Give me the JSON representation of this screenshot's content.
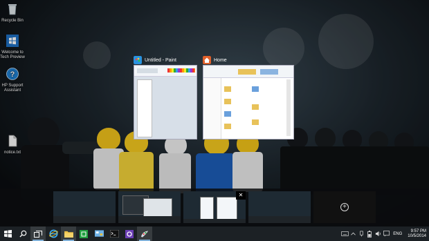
{
  "desktop": {
    "icons": [
      {
        "label": "Recycle Bin",
        "icon": "recycle-bin-icon"
      },
      {
        "label": "Welcome to Tech Preview",
        "icon": "windows-logo-icon"
      },
      {
        "label": "HP Support Assistant",
        "icon": "help-icon"
      },
      {
        "label": "notice.txt",
        "icon": "text-file-icon"
      }
    ]
  },
  "task_view": {
    "windows": [
      {
        "title": "Untitled - Paint",
        "icon": "paint-icon",
        "accent": "#1e90e0"
      },
      {
        "title": "Home",
        "icon": "home-icon",
        "accent": "#e06020"
      }
    ],
    "desktops": [
      {
        "name": "desktop-1"
      },
      {
        "name": "desktop-2"
      },
      {
        "name": "desktop-3",
        "close_symbol": "✕"
      },
      {
        "name": "desktop-4"
      }
    ],
    "new_desktop_symbol": "+"
  },
  "taskbar": {
    "pinned": [
      {
        "icon": "start-icon"
      },
      {
        "icon": "search-icon"
      },
      {
        "icon": "task-view-icon"
      },
      {
        "icon": "internet-explorer-icon"
      },
      {
        "icon": "file-explorer-icon"
      },
      {
        "icon": "store-icon"
      },
      {
        "icon": "control-panel-icon"
      },
      {
        "icon": "command-prompt-icon"
      },
      {
        "icon": "visual-studio-icon"
      },
      {
        "icon": "paint-icon"
      }
    ],
    "tray": {
      "language": "ENG",
      "time": "9:57 PM",
      "date": "10/5/2014"
    }
  },
  "colors": {
    "taskbar": "#1c2125",
    "accent": "#7fb0d8"
  }
}
